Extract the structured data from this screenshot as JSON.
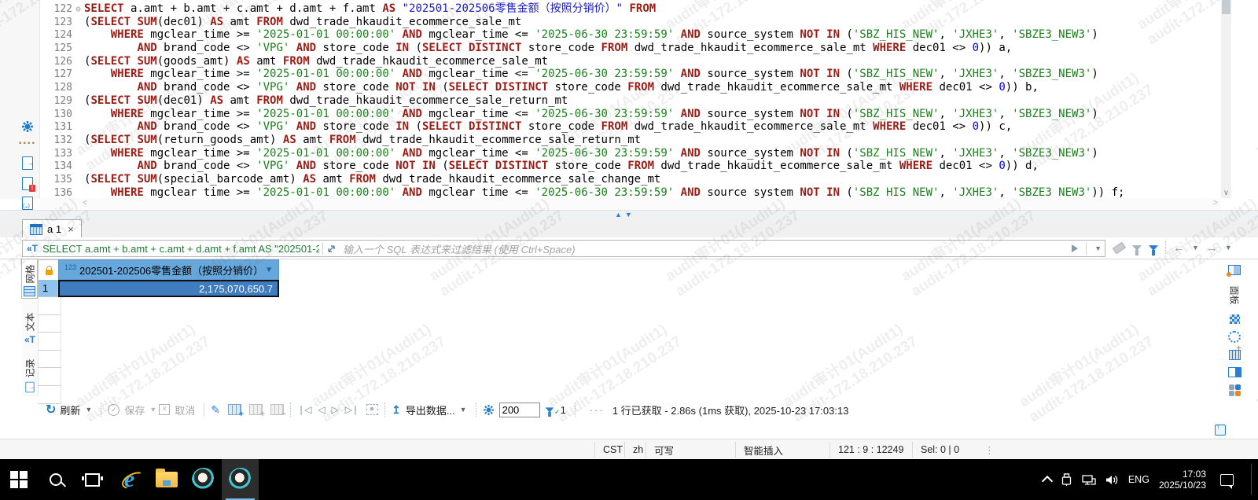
{
  "watermark": {
    "line1": "audit审计01(Audit1)",
    "line2": "audit-172.18.210.237"
  },
  "editor": {
    "lines": [
      {
        "num": "122",
        "fold": true,
        "tokens": [
          [
            "k",
            "SELECT"
          ],
          [
            "p",
            " a.amt + b.amt + c.amt + d.amt + f.amt "
          ],
          [
            "k",
            "AS"
          ],
          [
            "p",
            " "
          ],
          [
            "q",
            "\"202501-202506零售金额（按照分销价）\""
          ],
          [
            "p",
            " "
          ],
          [
            "k",
            "FROM"
          ]
        ]
      },
      {
        "num": "123",
        "tokens": [
          [
            "p",
            "("
          ],
          [
            "k",
            "SELECT"
          ],
          [
            "p",
            " "
          ],
          [
            "k",
            "SUM"
          ],
          [
            "p",
            "(dec01) "
          ],
          [
            "k",
            "AS"
          ],
          [
            "p",
            " amt "
          ],
          [
            "k",
            "FROM"
          ],
          [
            "p",
            " dwd_trade_hkaudit_ecommerce_sale_mt"
          ]
        ]
      },
      {
        "num": "124",
        "tokens": [
          [
            "p",
            "    "
          ],
          [
            "k",
            "WHERE"
          ],
          [
            "p",
            " mgclear_time >= "
          ],
          [
            "s",
            "'2025-01-01 00:00:00'"
          ],
          [
            "p",
            " "
          ],
          [
            "k",
            "AND"
          ],
          [
            "p",
            " mgclear_time <= "
          ],
          [
            "s",
            "'2025-06-30 23:59:59'"
          ],
          [
            "p",
            " "
          ],
          [
            "k",
            "AND"
          ],
          [
            "p",
            " source_system "
          ],
          [
            "k",
            "NOT"
          ],
          [
            "p",
            " "
          ],
          [
            "k",
            "IN"
          ],
          [
            "p",
            " ("
          ],
          [
            "s",
            "'SBZ_HIS_NEW'"
          ],
          [
            "p",
            ", "
          ],
          [
            "s",
            "'JXHE3'"
          ],
          [
            "p",
            ", "
          ],
          [
            "s",
            "'SBZE3_NEW3'"
          ],
          [
            "p",
            ")"
          ]
        ]
      },
      {
        "num": "125",
        "tokens": [
          [
            "p",
            "        "
          ],
          [
            "k",
            "AND"
          ],
          [
            "p",
            " brand_code <> "
          ],
          [
            "s",
            "'VPG'"
          ],
          [
            "p",
            " "
          ],
          [
            "k",
            "AND"
          ],
          [
            "p",
            " store_code "
          ],
          [
            "k",
            "IN"
          ],
          [
            "p",
            " ("
          ],
          [
            "k",
            "SELECT"
          ],
          [
            "p",
            " "
          ],
          [
            "k",
            "DISTINCT"
          ],
          [
            "p",
            " store_code "
          ],
          [
            "k",
            "FROM"
          ],
          [
            "p",
            " dwd_trade_hkaudit_ecommerce_sale_mt "
          ],
          [
            "k",
            "WHERE"
          ],
          [
            "p",
            " dec01 <> "
          ],
          [
            "n",
            "0"
          ],
          [
            "p",
            ")) a,"
          ]
        ]
      },
      {
        "num": "126",
        "tokens": [
          [
            "p",
            "("
          ],
          [
            "k",
            "SELECT"
          ],
          [
            "p",
            " "
          ],
          [
            "k",
            "SUM"
          ],
          [
            "p",
            "(goods_amt) "
          ],
          [
            "k",
            "AS"
          ],
          [
            "p",
            " amt "
          ],
          [
            "k",
            "FROM"
          ],
          [
            "p",
            " dwd_trade_hkaudit_ecommerce_sale_mt"
          ]
        ]
      },
      {
        "num": "127",
        "tokens": [
          [
            "p",
            "    "
          ],
          [
            "k",
            "WHERE"
          ],
          [
            "p",
            " mgclear_time >= "
          ],
          [
            "s",
            "'2025-01-01 00:00:00'"
          ],
          [
            "p",
            " "
          ],
          [
            "k",
            "AND"
          ],
          [
            "p",
            " mgclear_time <= "
          ],
          [
            "s",
            "'2025-06-30 23:59:59'"
          ],
          [
            "p",
            " "
          ],
          [
            "k",
            "AND"
          ],
          [
            "p",
            " source_system "
          ],
          [
            "k",
            "NOT"
          ],
          [
            "p",
            " "
          ],
          [
            "k",
            "IN"
          ],
          [
            "p",
            " ("
          ],
          [
            "s",
            "'SBZ_HIS_NEW'"
          ],
          [
            "p",
            ", "
          ],
          [
            "s",
            "'JXHE3'"
          ],
          [
            "p",
            ", "
          ],
          [
            "s",
            "'SBZE3_NEW3'"
          ],
          [
            "p",
            ")"
          ]
        ]
      },
      {
        "num": "128",
        "tokens": [
          [
            "p",
            "        "
          ],
          [
            "k",
            "AND"
          ],
          [
            "p",
            " brand_code <> "
          ],
          [
            "s",
            "'VPG'"
          ],
          [
            "p",
            " "
          ],
          [
            "k",
            "AND"
          ],
          [
            "p",
            " store_code "
          ],
          [
            "k",
            "NOT"
          ],
          [
            "p",
            " "
          ],
          [
            "k",
            "IN"
          ],
          [
            "p",
            " ("
          ],
          [
            "k",
            "SELECT"
          ],
          [
            "p",
            " "
          ],
          [
            "k",
            "DISTINCT"
          ],
          [
            "p",
            " store_code "
          ],
          [
            "k",
            "FROM"
          ],
          [
            "p",
            " dwd_trade_hkaudit_ecommerce_sale_mt "
          ],
          [
            "k",
            "WHERE"
          ],
          [
            "p",
            " dec01 <> "
          ],
          [
            "n",
            "0"
          ],
          [
            "p",
            ")) b,"
          ]
        ]
      },
      {
        "num": "129",
        "tokens": [
          [
            "p",
            "("
          ],
          [
            "k",
            "SELECT"
          ],
          [
            "p",
            " "
          ],
          [
            "k",
            "SUM"
          ],
          [
            "p",
            "(dec01) "
          ],
          [
            "k",
            "AS"
          ],
          [
            "p",
            " amt "
          ],
          [
            "k",
            "FROM"
          ],
          [
            "p",
            " dwd_trade_hkaudit_ecommerce_sale_return_mt"
          ]
        ]
      },
      {
        "num": "130",
        "tokens": [
          [
            "p",
            "    "
          ],
          [
            "k",
            "WHERE"
          ],
          [
            "p",
            " mgclear_time >= "
          ],
          [
            "s",
            "'2025-01-01 00:00:00'"
          ],
          [
            "p",
            " "
          ],
          [
            "k",
            "AND"
          ],
          [
            "p",
            " mgclear_time <= "
          ],
          [
            "s",
            "'2025-06-30 23:59:59'"
          ],
          [
            "p",
            " "
          ],
          [
            "k",
            "AND"
          ],
          [
            "p",
            " source_system "
          ],
          [
            "k",
            "NOT"
          ],
          [
            "p",
            " "
          ],
          [
            "k",
            "IN"
          ],
          [
            "p",
            " ("
          ],
          [
            "s",
            "'SBZ_HIS_NEW'"
          ],
          [
            "p",
            ", "
          ],
          [
            "s",
            "'JXHE3'"
          ],
          [
            "p",
            ", "
          ],
          [
            "s",
            "'SBZE3_NEW3'"
          ],
          [
            "p",
            ")"
          ]
        ]
      },
      {
        "num": "131",
        "tokens": [
          [
            "p",
            "        "
          ],
          [
            "k",
            "AND"
          ],
          [
            "p",
            " brand_code <> "
          ],
          [
            "s",
            "'VPG'"
          ],
          [
            "p",
            " "
          ],
          [
            "k",
            "AND"
          ],
          [
            "p",
            " store_code "
          ],
          [
            "k",
            "IN"
          ],
          [
            "p",
            " ("
          ],
          [
            "k",
            "SELECT"
          ],
          [
            "p",
            " "
          ],
          [
            "k",
            "DISTINCT"
          ],
          [
            "p",
            " store_code "
          ],
          [
            "k",
            "FROM"
          ],
          [
            "p",
            " dwd_trade_hkaudit_ecommerce_sale_mt "
          ],
          [
            "k",
            "WHERE"
          ],
          [
            "p",
            " dec01 <> "
          ],
          [
            "n",
            "0"
          ],
          [
            "p",
            ")) c,"
          ]
        ]
      },
      {
        "num": "132",
        "tokens": [
          [
            "p",
            "("
          ],
          [
            "k",
            "SELECT"
          ],
          [
            "p",
            " "
          ],
          [
            "k",
            "SUM"
          ],
          [
            "p",
            "(return_goods_amt) "
          ],
          [
            "k",
            "AS"
          ],
          [
            "p",
            " amt "
          ],
          [
            "k",
            "FROM"
          ],
          [
            "p",
            " dwd_trade_hkaudit_ecommerce_sale_return_mt"
          ]
        ]
      },
      {
        "num": "133",
        "tokens": [
          [
            "p",
            "    "
          ],
          [
            "k",
            "WHERE"
          ],
          [
            "p",
            " mgclear_time >= "
          ],
          [
            "s",
            "'2025-01-01 00:00:00'"
          ],
          [
            "p",
            " "
          ],
          [
            "k",
            "AND"
          ],
          [
            "p",
            " mgclear_time <= "
          ],
          [
            "s",
            "'2025-06-30 23:59:59'"
          ],
          [
            "p",
            " "
          ],
          [
            "k",
            "AND"
          ],
          [
            "p",
            " source_system "
          ],
          [
            "k",
            "NOT"
          ],
          [
            "p",
            " "
          ],
          [
            "k",
            "IN"
          ],
          [
            "p",
            " ("
          ],
          [
            "s",
            "'SBZ_HIS_NEW'"
          ],
          [
            "p",
            ", "
          ],
          [
            "s",
            "'JXHE3'"
          ],
          [
            "p",
            ", "
          ],
          [
            "s",
            "'SBZE3_NEW3'"
          ],
          [
            "p",
            ")"
          ]
        ]
      },
      {
        "num": "134",
        "tokens": [
          [
            "p",
            "        "
          ],
          [
            "k",
            "AND"
          ],
          [
            "p",
            " brand_code <> "
          ],
          [
            "s",
            "'VPG'"
          ],
          [
            "p",
            " "
          ],
          [
            "k",
            "AND"
          ],
          [
            "p",
            " store_code "
          ],
          [
            "k",
            "NOT"
          ],
          [
            "p",
            " "
          ],
          [
            "k",
            "IN"
          ],
          [
            "p",
            " ("
          ],
          [
            "k",
            "SELECT"
          ],
          [
            "p",
            " "
          ],
          [
            "k",
            "DISTINCT"
          ],
          [
            "p",
            " store_code "
          ],
          [
            "k",
            "FROM"
          ],
          [
            "p",
            " dwd_trade_hkaudit_ecommerce_sale_mt "
          ],
          [
            "k",
            "WHERE"
          ],
          [
            "p",
            " dec01 <> "
          ],
          [
            "n",
            "0"
          ],
          [
            "p",
            ")) d,"
          ]
        ]
      },
      {
        "num": "135",
        "tokens": [
          [
            "p",
            "("
          ],
          [
            "k",
            "SELECT"
          ],
          [
            "p",
            " "
          ],
          [
            "k",
            "SUM"
          ],
          [
            "p",
            "(special_barcode_amt) "
          ],
          [
            "k",
            "AS"
          ],
          [
            "p",
            " amt "
          ],
          [
            "k",
            "FROM"
          ],
          [
            "p",
            " dwd_trade_hkaudit_ecommerce_sale_change_mt"
          ]
        ]
      },
      {
        "num": "136",
        "tokens": [
          [
            "p",
            "    "
          ],
          [
            "k",
            "WHERE"
          ],
          [
            "p",
            " mgclear_time >= "
          ],
          [
            "s",
            "'2025-01-01 00:00:00'"
          ],
          [
            "p",
            " "
          ],
          [
            "k",
            "AND"
          ],
          [
            "p",
            " mgclear_time <= "
          ],
          [
            "s",
            "'2025-06-30 23:59:59'"
          ],
          [
            "p",
            " "
          ],
          [
            "k",
            "AND"
          ],
          [
            "p",
            " source_system "
          ],
          [
            "k",
            "NOT"
          ],
          [
            "p",
            " "
          ],
          [
            "k",
            "IN"
          ],
          [
            "p",
            " ("
          ],
          [
            "s",
            "'SBZ_HIS_NEW'"
          ],
          [
            "p",
            ", "
          ],
          [
            "s",
            "'JXHE3'"
          ],
          [
            "p",
            ", "
          ],
          [
            "s",
            "'SBZE3_NEW3'"
          ],
          [
            "p",
            ")) f;"
          ]
        ]
      }
    ]
  },
  "results": {
    "tab": {
      "label": "a 1"
    },
    "filter": {
      "expr": "SELECT a.amt + b.amt + c.amt + d.amt + f.amt AS \"202501-202",
      "placeholder": "输入一个 SQL 表达式来过滤结果 (使用 Ctrl+Space)"
    },
    "side_tabs": [
      {
        "label": "网格"
      },
      {
        "label": "文本"
      },
      {
        "label": "记录"
      }
    ],
    "grid": {
      "col_type": "123",
      "col_header": "202501-202506零售金额（按照分销价）",
      "row_num": "1",
      "value": "2,175,070,650.7"
    },
    "right_panel_label": "面板",
    "toolbar": {
      "refresh": "刷新",
      "save": "保存",
      "cancel": "取消",
      "export": "导出数据...",
      "fetch_size": "200",
      "fetch_page": "1",
      "status": "1 行已获取 - 2.86s (1ms 获取), 2025-10-23 17:03:13"
    }
  },
  "statusbar": {
    "tz": "CST",
    "lang": "zh",
    "writable": "可写",
    "insert_mode": "智能插入",
    "position": "121 : 9 : 12249",
    "selection": "Sel: 0 | 0"
  },
  "taskbar": {
    "lang": "ENG",
    "time": "17:03",
    "date": "2025/10/23"
  }
}
